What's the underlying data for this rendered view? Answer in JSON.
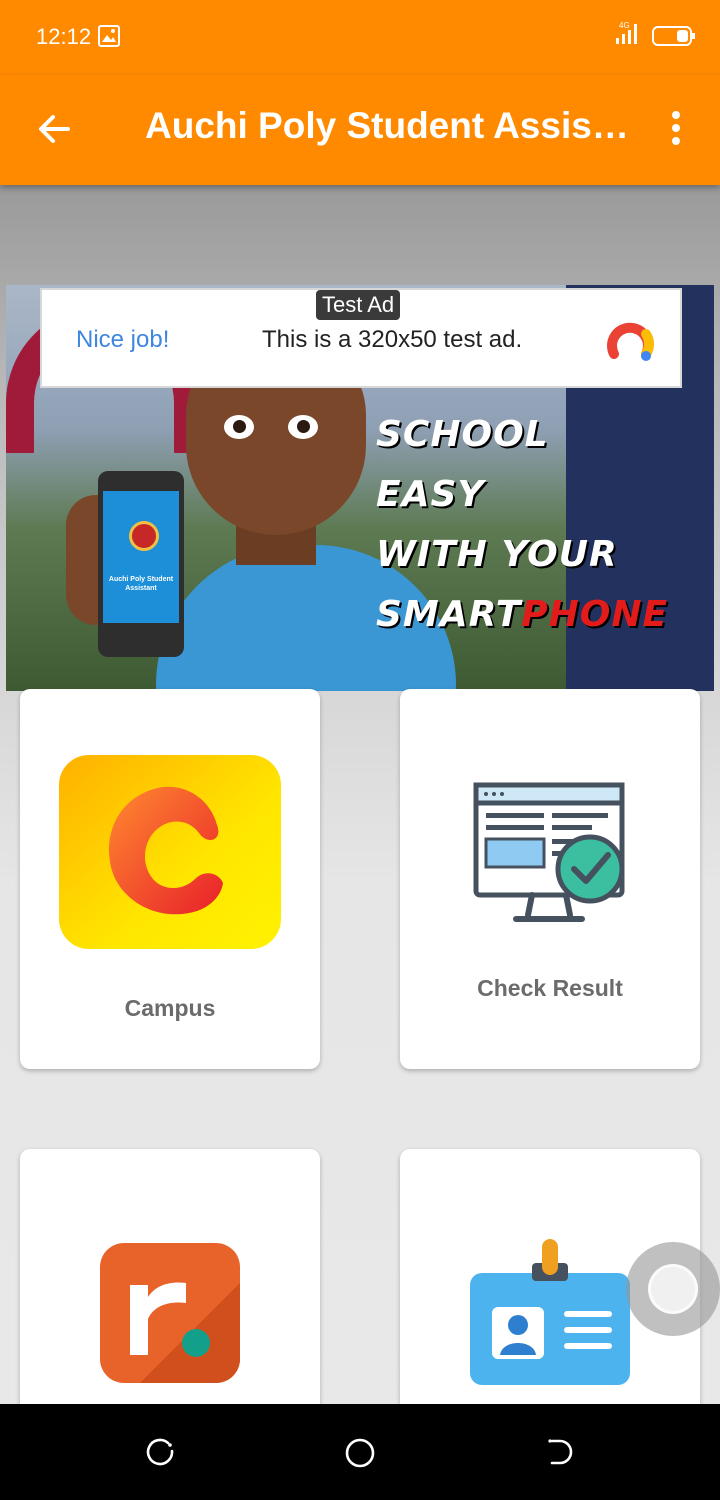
{
  "status_bar": {
    "time": "12:12",
    "network": "4G"
  },
  "app_bar": {
    "title": "Auchi Poly Student Assis…"
  },
  "banner": {
    "slogan_lines": [
      "SCHOOL",
      "EASY",
      "WITH YOUR"
    ],
    "slogan_last_white": "SMART",
    "slogan_last_red": "PHONE",
    "phone_app_name": "Auchi Poly Student Assistant"
  },
  "ad": {
    "tag": "Test Ad",
    "headline": "Nice job!",
    "message": "This is a 320x50 test ad."
  },
  "cards": [
    {
      "label": "Campus"
    },
    {
      "label": "Check Result"
    },
    {
      "label": ""
    },
    {
      "label": ""
    }
  ],
  "colors": {
    "primary": "#ff8a00"
  }
}
